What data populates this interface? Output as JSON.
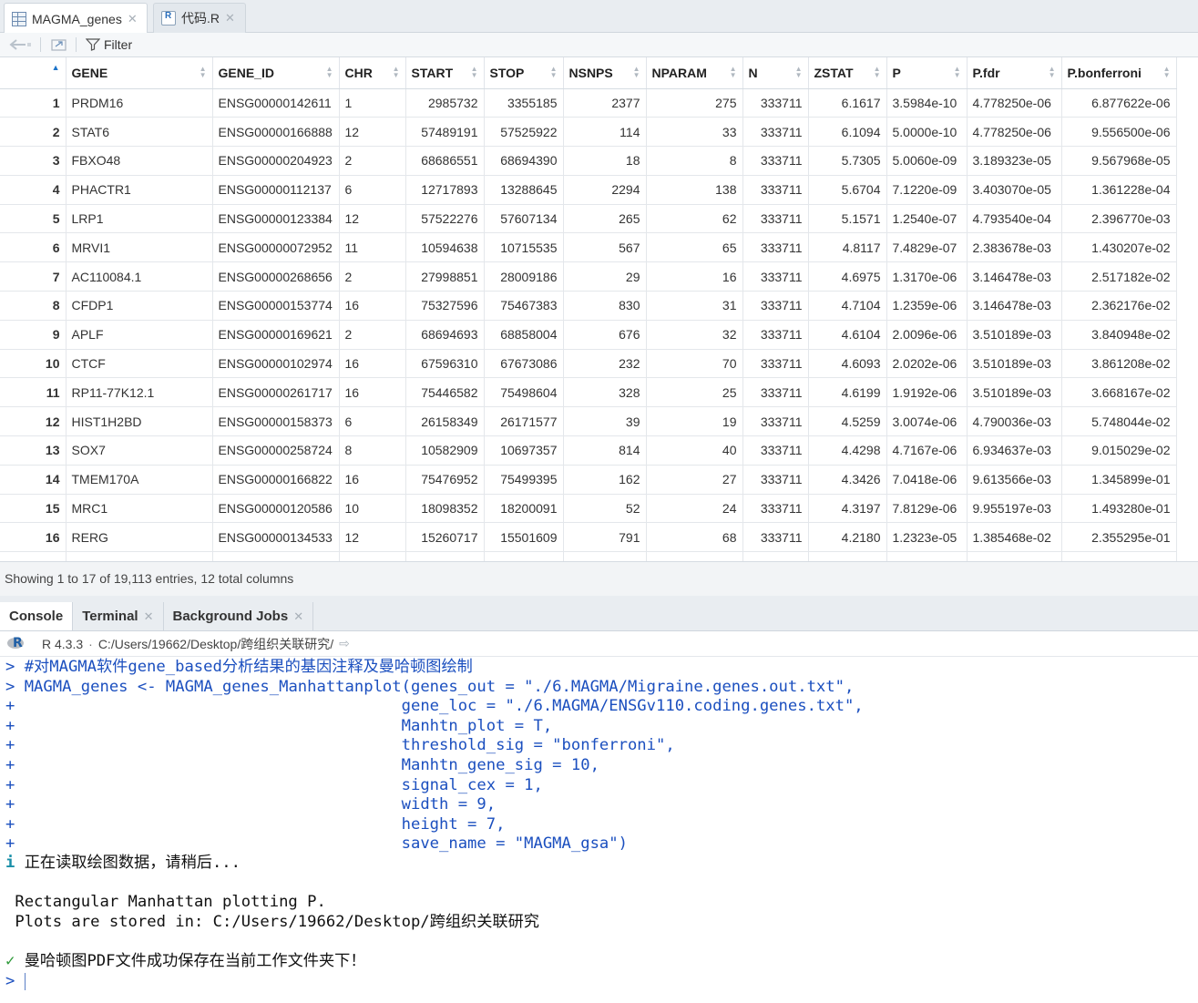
{
  "editor_tabs": [
    {
      "label": "MAGMA_genes",
      "icon": "table-icon",
      "active": true
    },
    {
      "label": "代码.R",
      "icon": "r-file-icon",
      "active": false
    }
  ],
  "toolbar": {
    "filter_label": "Filter"
  },
  "table": {
    "columns": [
      "",
      "GENE",
      "GENE_ID",
      "CHR",
      "START",
      "STOP",
      "NSNPS",
      "NPARAM",
      "N",
      "ZSTAT",
      "P",
      "P.fdr",
      "P.bonferroni"
    ],
    "rows": [
      [
        "1",
        "PRDM16",
        "ENSG00000142611",
        "1",
        "2985732",
        "3355185",
        "2377",
        "275",
        "333711",
        "6.1617",
        "3.5984e-10",
        "4.778250e-06",
        "6.877622e-06"
      ],
      [
        "2",
        "STAT6",
        "ENSG00000166888",
        "12",
        "57489191",
        "57525922",
        "114",
        "33",
        "333711",
        "6.1094",
        "5.0000e-10",
        "4.778250e-06",
        "9.556500e-06"
      ],
      [
        "3",
        "FBXO48",
        "ENSG00000204923",
        "2",
        "68686551",
        "68694390",
        "18",
        "8",
        "333711",
        "5.7305",
        "5.0060e-09",
        "3.189323e-05",
        "9.567968e-05"
      ],
      [
        "4",
        "PHACTR1",
        "ENSG00000112137",
        "6",
        "12717893",
        "13288645",
        "2294",
        "138",
        "333711",
        "5.6704",
        "7.1220e-09",
        "3.403070e-05",
        "1.361228e-04"
      ],
      [
        "5",
        "LRP1",
        "ENSG00000123384",
        "12",
        "57522276",
        "57607134",
        "265",
        "62",
        "333711",
        "5.1571",
        "1.2540e-07",
        "4.793540e-04",
        "2.396770e-03"
      ],
      [
        "6",
        "MRVI1",
        "ENSG00000072952",
        "11",
        "10594638",
        "10715535",
        "567",
        "65",
        "333711",
        "4.8117",
        "7.4829e-07",
        "2.383678e-03",
        "1.430207e-02"
      ],
      [
        "7",
        "AC110084.1",
        "ENSG00000268656",
        "2",
        "27998851",
        "28009186",
        "29",
        "16",
        "333711",
        "4.6975",
        "1.3170e-06",
        "3.146478e-03",
        "2.517182e-02"
      ],
      [
        "8",
        "CFDP1",
        "ENSG00000153774",
        "16",
        "75327596",
        "75467383",
        "830",
        "31",
        "333711",
        "4.7104",
        "1.2359e-06",
        "3.146478e-03",
        "2.362176e-02"
      ],
      [
        "9",
        "APLF",
        "ENSG00000169621",
        "2",
        "68694693",
        "68858004",
        "676",
        "32",
        "333711",
        "4.6104",
        "2.0096e-06",
        "3.510189e-03",
        "3.840948e-02"
      ],
      [
        "10",
        "CTCF",
        "ENSG00000102974",
        "16",
        "67596310",
        "67673086",
        "232",
        "70",
        "333711",
        "4.6093",
        "2.0202e-06",
        "3.510189e-03",
        "3.861208e-02"
      ],
      [
        "11",
        "RP11-77K12.1",
        "ENSG00000261717",
        "16",
        "75446582",
        "75498604",
        "328",
        "25",
        "333711",
        "4.6199",
        "1.9192e-06",
        "3.510189e-03",
        "3.668167e-02"
      ],
      [
        "12",
        "HIST1H2BD",
        "ENSG00000158373",
        "6",
        "26158349",
        "26171577",
        "39",
        "19",
        "333711",
        "4.5259",
        "3.0074e-06",
        "4.790036e-03",
        "5.748044e-02"
      ],
      [
        "13",
        "SOX7",
        "ENSG00000258724",
        "8",
        "10582909",
        "10697357",
        "814",
        "40",
        "333711",
        "4.4298",
        "4.7167e-06",
        "6.934637e-03",
        "9.015029e-02"
      ],
      [
        "14",
        "TMEM170A",
        "ENSG00000166822",
        "16",
        "75476952",
        "75499395",
        "162",
        "27",
        "333711",
        "4.3426",
        "7.0418e-06",
        "9.613566e-03",
        "1.345899e-01"
      ],
      [
        "15",
        "MRC1",
        "ENSG00000120586",
        "10",
        "18098352",
        "18200091",
        "52",
        "24",
        "333711",
        "4.3197",
        "7.8129e-06",
        "9.955197e-03",
        "1.493280e-01"
      ],
      [
        "16",
        "RERG",
        "ENSG00000134533",
        "12",
        "15260717",
        "15501609",
        "791",
        "68",
        "333711",
        "4.2180",
        "1.2323e-05",
        "1.385468e-02",
        "2.355295e-01"
      ]
    ],
    "status": "Showing 1 to 17 of 19,113 entries, 12 total columns"
  },
  "console_tabs": [
    {
      "label": "Console",
      "active": true,
      "closable": false
    },
    {
      "label": "Terminal",
      "active": false,
      "closable": true
    },
    {
      "label": "Background Jobs",
      "active": false,
      "closable": true
    }
  ],
  "console_header": {
    "r_version": "R 4.3.3",
    "separator": "·",
    "path": "C:/Users/19662/Desktop/跨组织关联研究/"
  },
  "console_lines": [
    {
      "prompt": ">",
      "text": " #对MAGMA软件gene_based分析结果的基因注释及曼哈顿图绘制",
      "color": "blue"
    },
    {
      "prompt": ">",
      "text": " MAGMA_genes <- MAGMA_genes_Manhattanplot(genes_out = \"./6.MAGMA/Migraine.genes.out.txt\",",
      "color": "blue"
    },
    {
      "prompt": "+",
      "text": "                                         gene_loc = \"./6.MAGMA/ENSGv110.coding.genes.txt\",",
      "color": "blue"
    },
    {
      "prompt": "+",
      "text": "                                         Manhtn_plot = T,",
      "color": "blue"
    },
    {
      "prompt": "+",
      "text": "                                         threshold_sig = \"bonferroni\",",
      "color": "blue"
    },
    {
      "prompt": "+",
      "text": "                                         Manhtn_gene_sig = 10,",
      "color": "blue"
    },
    {
      "prompt": "+",
      "text": "                                         signal_cex = 1,",
      "color": "blue"
    },
    {
      "prompt": "+",
      "text": "                                         width = 9,",
      "color": "blue"
    },
    {
      "prompt": "+",
      "text": "                                         height = 7,",
      "color": "blue"
    },
    {
      "prompt": "+",
      "text": "                                         save_name = \"MAGMA_gsa\")",
      "color": "blue"
    },
    {
      "prompt": "i",
      "text": " 正在读取绘图数据，请稍后...",
      "color": "black",
      "prompt_color": "cyan"
    },
    {
      "prompt": "",
      "text": "",
      "color": "black"
    },
    {
      "prompt": "",
      "text": " Rectangular Manhattan plotting P.",
      "color": "black"
    },
    {
      "prompt": "",
      "text": " Plots are stored in: C:/Users/19662/Desktop/跨组织关联研究",
      "color": "black"
    },
    {
      "prompt": "",
      "text": "",
      "color": "black"
    },
    {
      "prompt": "✓",
      "text": " 曼哈顿图PDF文件成功保存在当前工作文件夹下！",
      "color": "black",
      "prompt_color": "green"
    },
    {
      "prompt": ">",
      "text": " ",
      "color": "blue",
      "cursor": true
    }
  ]
}
